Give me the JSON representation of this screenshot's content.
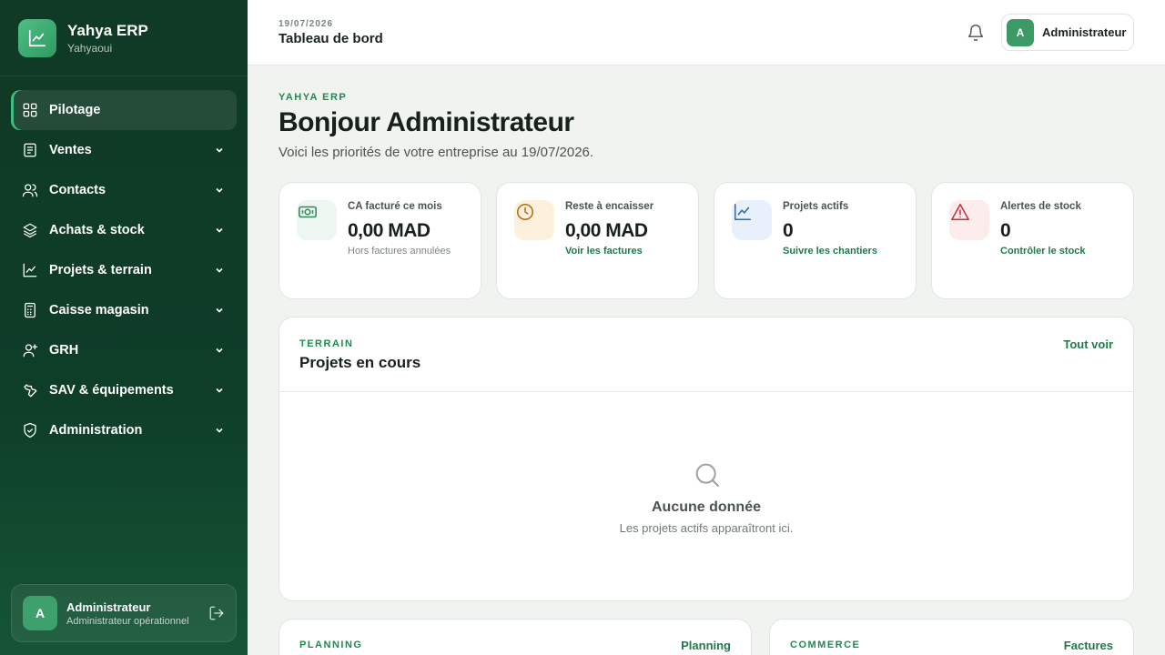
{
  "sidebar": {
    "brand_name": "Yahya ERP",
    "brand_sub": "Yahyaoui",
    "items": [
      {
        "label": "Pilotage",
        "icon": "grid-icon",
        "active": true
      },
      {
        "label": "Ventes",
        "icon": "receipt-icon"
      },
      {
        "label": "Contacts",
        "icon": "users-icon"
      },
      {
        "label": "Achats & stock",
        "icon": "layers-icon"
      },
      {
        "label": "Projets & terrain",
        "icon": "line-chart-icon"
      },
      {
        "label": "Caisse magasin",
        "icon": "calculator-icon"
      },
      {
        "label": "GRH",
        "icon": "user-plus-icon"
      },
      {
        "label": "SAV & équipements",
        "icon": "wrench-icon"
      },
      {
        "label": "Administration",
        "icon": "shield-icon"
      }
    ],
    "user": {
      "initial": "A",
      "name": "Administrateur",
      "role": "Administrateur opérationnel"
    }
  },
  "topbar": {
    "date": "19/07/2026",
    "title": "Tableau de bord",
    "user_initial": "A",
    "user_name": "Administrateur"
  },
  "hero": {
    "kicker": "YAHYA ERP",
    "title": "Bonjour Administrateur",
    "subtitle": "Voici les priorités de votre entreprise au 19/07/2026."
  },
  "kpis": [
    {
      "label": "CA facturé ce mois",
      "value": "0,00 MAD",
      "note": "Hors factures annulées",
      "icon": "cash-icon",
      "color": "#2f8a58"
    },
    {
      "label": "Reste à encaisser",
      "value": "0,00 MAD",
      "link": "Voir les factures",
      "icon": "clock-icon",
      "color": "#b4700f"
    },
    {
      "label": "Projets actifs",
      "value": "0",
      "link": "Suivre les chantiers",
      "icon": "trend-icon",
      "color": "#2b6fb0"
    },
    {
      "label": "Alertes de stock",
      "value": "0",
      "link": "Contrôler le stock",
      "icon": "warning-icon",
      "color": "#c8323a"
    }
  ],
  "projects_panel": {
    "kicker": "TERRAIN",
    "title": "Projets en cours",
    "link": "Tout voir",
    "empty_title": "Aucune donnée",
    "empty_sub": "Les projets actifs apparaîtront ici."
  },
  "planning_card": {
    "kicker": "PLANNING",
    "link": "Planning"
  },
  "commerce_card": {
    "kicker": "COMMERCE",
    "link": "Factures"
  },
  "colors": {
    "accent": "#1f8a4f",
    "sidebar_bg": "#0f3a25"
  }
}
